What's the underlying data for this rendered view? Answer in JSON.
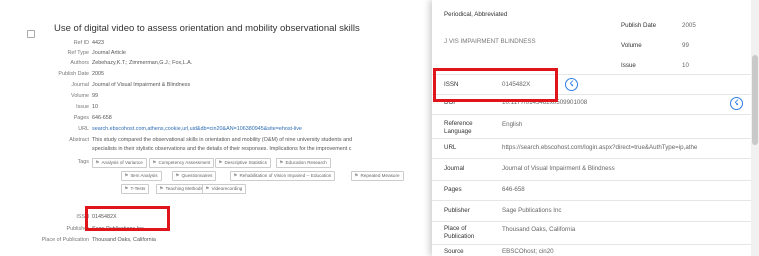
{
  "record": {
    "title": "Use of digital video to assess orientation and mobility observational skills",
    "fields": [
      {
        "key": "Ref ID",
        "value": "4423"
      },
      {
        "key": "Ref Type",
        "value": "Journal Article"
      },
      {
        "key": "Authors",
        "value": "Zebehazy,K.T.; Zimmerman,G.J.; Fox,L.A."
      },
      {
        "key": "Publish Date",
        "value": "2005"
      },
      {
        "key": "Journal",
        "value": "Journal of Visual Impairment & Blindness"
      },
      {
        "key": "Volume",
        "value": "99"
      },
      {
        "key": "Issue",
        "value": "10"
      },
      {
        "key": "Pages",
        "value": "646-658"
      }
    ],
    "url_key": "URL",
    "url_value": "search.ebscohost.com,athens,cookie,url,uid&db=cin20&AN=106380945&site=ehost-live",
    "abstract_key": "Abstract",
    "abstract_lines": [
      "This study compared the observational skills in orientation and mobility (O&M) of nine university students and",
      "specialists in their stylistic observations and the details of their responses. Implications for the improvement c"
    ],
    "tags_key": "Tags",
    "tags": [
      "Analysis of Variance",
      "Competency Assessment",
      "Descriptive Statistics",
      "Education Research",
      "Item Analysis",
      "Questionnaires",
      "Rehabilitation of Vision Impaired -- Education",
      "Repeated Measure",
      "T-Tests",
      "Teaching Methods",
      "Videorecording"
    ],
    "after_fields": [
      {
        "key": "ISSN",
        "value": "0145482X"
      },
      {
        "key": "Publisher",
        "value": "Sage Publications Inc"
      },
      {
        "key": "Place of Publication",
        "value": "Thousand Oaks, California"
      }
    ]
  },
  "detail": {
    "periodical_label": "Periodical, Abbreviated",
    "periodical_value": "J VIS IMPAIRMENT BLINDNESS",
    "publish_date_label": "Publish Date",
    "publish_date_value": "2005",
    "volume_label": "Volume",
    "volume_value": "99",
    "issue_label": "Issue",
    "issue_value": "10",
    "issn_label": "ISSN",
    "issn_value": "0145482X",
    "doi_label": "DOI",
    "doi_value": "10.1177/0145482x0509901008",
    "ref_lang_label": "Reference Language",
    "ref_lang_value": "English",
    "url_label": "URL",
    "url_value": "https://search.ebscohost.com/login.aspx?direct=true&AuthType=ip,athe",
    "journal_label": "Journal",
    "journal_value": "Journal of Visual Impairment & Blindness",
    "pages_label": "Pages",
    "pages_value": "646-658",
    "publisher_label": "Publisher",
    "publisher_value": "Sage Publications Inc",
    "place_label": "Place of Publication",
    "place_value": "Thousand Oaks, California",
    "source_label": "Source",
    "source_value": "EBSCOhost; cin20"
  },
  "icons": {
    "lookup": "lightning-icon",
    "tag": "tag-icon"
  },
  "colors": {
    "highlight": "#e0151b",
    "link": "#2d6cb3",
    "accent": "#2f7de1"
  }
}
